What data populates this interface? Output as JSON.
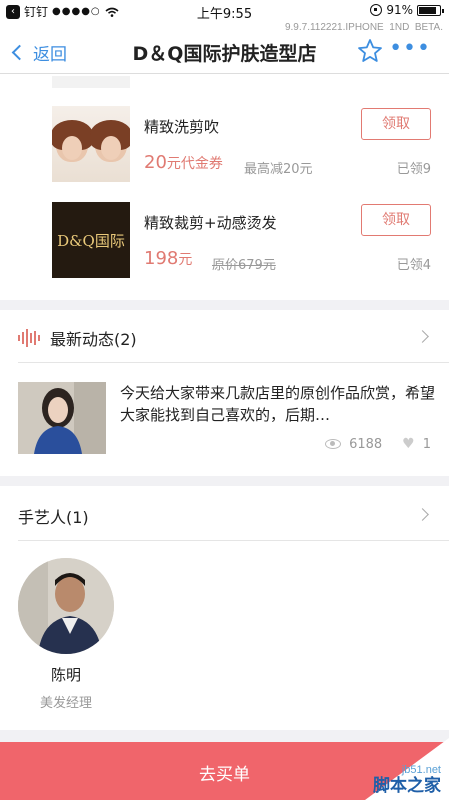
{
  "status_bar": {
    "back_app": "钉钉",
    "signal": "●●●●○",
    "time": "上午9:55",
    "battery": "91%",
    "battery_level": 0.91
  },
  "version_text": "9.9.7.112221.IPHONE_1ND_BETA.",
  "nav": {
    "back_label": "返回",
    "title": "D＆Q国际护肤造型店",
    "more_label": "•••"
  },
  "coupons": [
    {
      "name": "精致洗剪吹",
      "price": "20",
      "price_unit": "元代金券",
      "note": "最高减20元",
      "note_strike": false,
      "claim_label": "领取",
      "claimed": "已领9",
      "thumb": "faces"
    },
    {
      "name": "精致裁剪+动感烫发",
      "price": "198",
      "price_unit": "元",
      "note": "原价679元",
      "note_strike": true,
      "claim_label": "领取",
      "claimed": "已领4",
      "thumb": "logo",
      "thumb_text": "D&Q国际"
    }
  ],
  "news": {
    "title": "最新动态(2)",
    "post_text": "今天给大家带来几款店里的原创作品欣赏，希望大家能找到自己喜欢的，后期…",
    "views": "6188",
    "likes": "1"
  },
  "artisans": {
    "title": "手艺人(1)",
    "items": [
      {
        "name": "陈明",
        "role": "美发经理"
      }
    ]
  },
  "buy_label": "去买单",
  "watermark": {
    "url": "jb51.net",
    "name": "脚本之家"
  },
  "colors": {
    "accent_blue": "#3d8ee0",
    "accent_red": "#e07a72",
    "buy_bar": "#f0656b"
  }
}
